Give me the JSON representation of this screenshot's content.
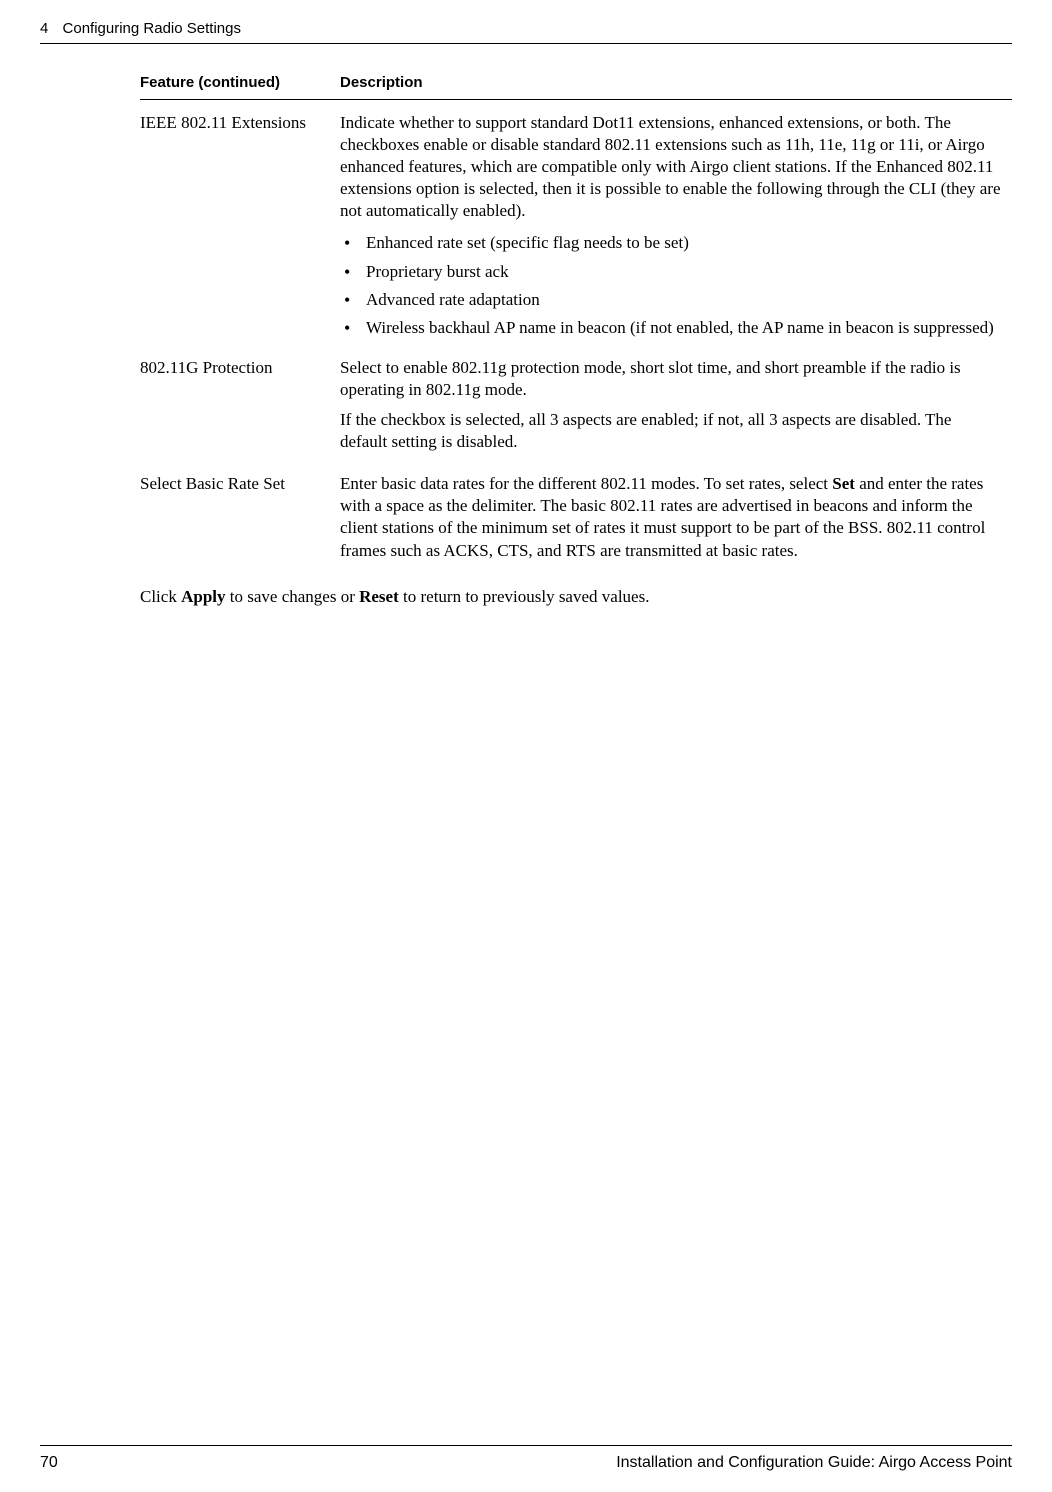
{
  "header": {
    "chapter_number": "4",
    "chapter_title": "Configuring Radio Settings"
  },
  "table": {
    "header": {
      "feature_label": "Feature",
      "continued_label": "(continued)",
      "description_label": "Description"
    },
    "rows": [
      {
        "feature": "IEEE 802.11 Extensions",
        "description_intro": "Indicate whether to support standard Dot11 extensions, enhanced extensions, or both. The checkboxes enable or disable standard 802.11 extensions such as 11h, 11e, 11g or 11i, or Airgo enhanced features, which are compatible only with Airgo client stations. If the Enhanced 802.11 extensions option is selected, then it is possible to enable the following through the CLI (they are not automatically enabled).",
        "bullets": [
          "Enhanced rate set (specific flag needs to be set)",
          "Proprietary burst ack",
          "Advanced rate adaptation",
          "Wireless backhaul AP name in beacon (if not enabled, the AP name in beacon is suppressed)"
        ]
      },
      {
        "feature": "802.11G Protection",
        "description_para1": "Select to enable 802.11g protection mode, short slot time, and short preamble if the radio is operating in 802.11g mode.",
        "description_para2": "If the checkbox is selected, all 3 aspects are enabled; if not, all 3 aspects are disabled. The default setting is disabled."
      },
      {
        "feature": "Select Basic Rate Set",
        "description_pre": "Enter basic data rates for the different 802.11 modes. To set rates, select ",
        "description_bold": "Set",
        "description_post": " and enter the rates with a space as the delimiter. The basic 802.11 rates are advertised in beacons and inform the client stations of the minimum set of rates it must support to be part of the BSS. 802.11 control frames such as ACKS, CTS, and RTS are transmitted at basic rates."
      }
    ]
  },
  "action": {
    "pre1": "Click ",
    "bold1": "Apply",
    "mid": " to save changes or ",
    "bold2": "Reset",
    "post": " to return to previously saved values."
  },
  "footer": {
    "page_number": "70",
    "doc_title": "Installation and Configuration Guide: Airgo Access Point"
  }
}
